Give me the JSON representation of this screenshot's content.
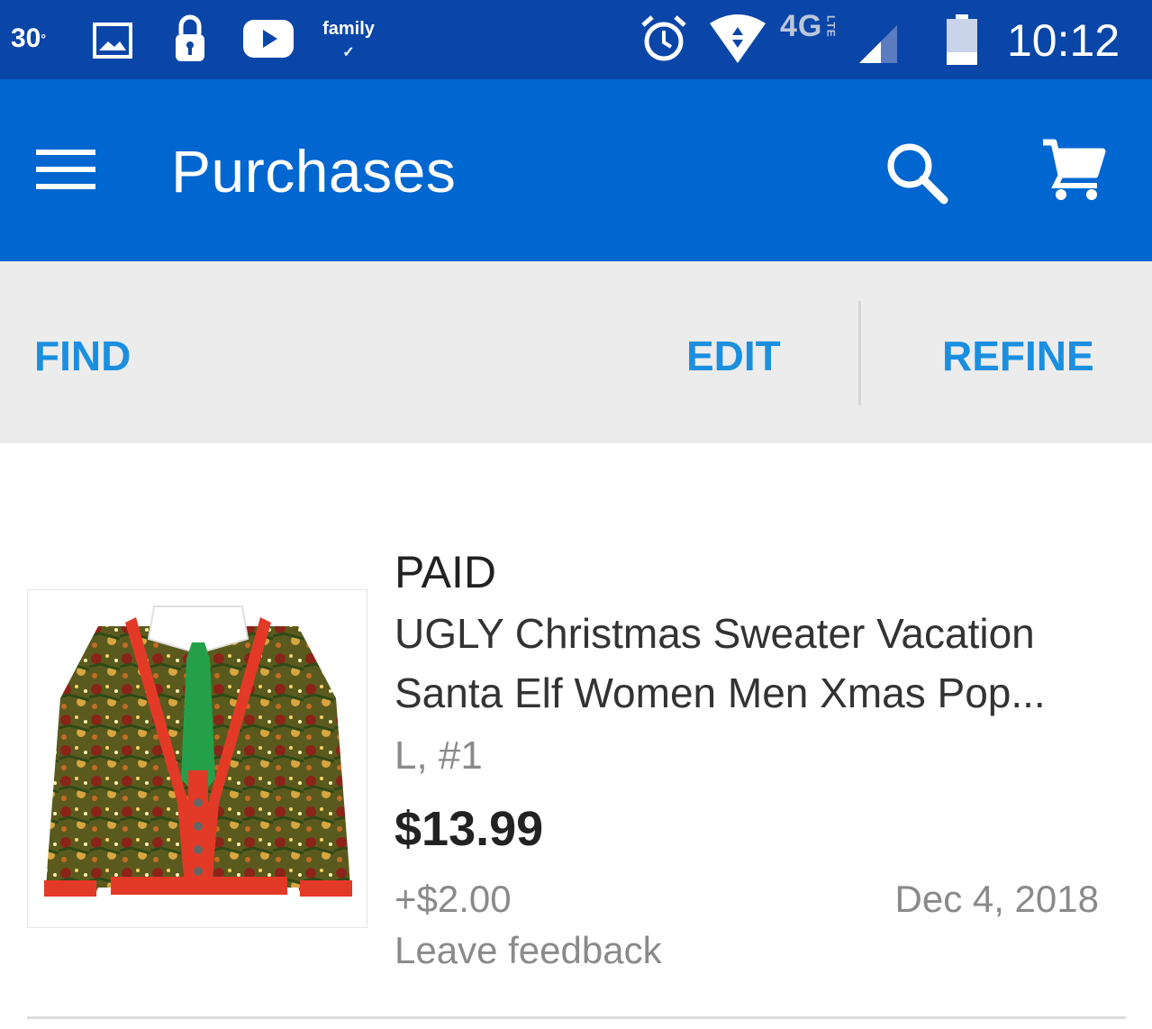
{
  "status_bar": {
    "temperature": "30",
    "degree": "°",
    "family_label": "family",
    "family_check": "✓",
    "network": "4G",
    "network_sub": "LTE",
    "time": "10:12"
  },
  "app_bar": {
    "title": "Purchases",
    "color": "#0066d0"
  },
  "toolbar": {
    "find": "FIND",
    "edit": "EDIT",
    "refine": "REFINE",
    "accent": "#1a8fe0"
  },
  "purchase": {
    "status": "PAID",
    "title": "UGLY Christmas Sweater Vacation Santa Elf Women Men Xmas Pop...",
    "variation": "L, #1",
    "price": "$13.99",
    "shipping": "+$2.00",
    "date": "Dec 4, 2018",
    "feedback_link": "Leave feedback",
    "image_icon": "christmas-sweater-image"
  }
}
